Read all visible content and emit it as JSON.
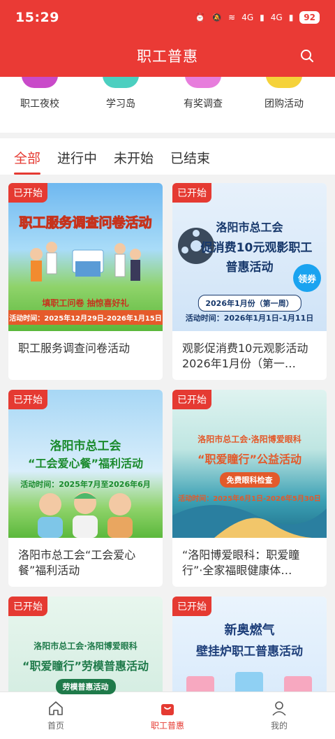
{
  "status_bar": {
    "time": "15:29",
    "signal1": "4G",
    "signal2": "4G",
    "battery": "92"
  },
  "header": {
    "title": "职工普惠"
  },
  "categories": [
    {
      "label": "职工夜校",
      "color": "#c94ac9"
    },
    {
      "label": "学习岛",
      "color": "#4ccfc0"
    },
    {
      "label": "有奖调查",
      "color": "#e77ddc"
    },
    {
      "label": "团购活动",
      "color": "#f5d23a"
    }
  ],
  "tabs": [
    "全部",
    "进行中",
    "未开始",
    "已结束"
  ],
  "cards": [
    {
      "badge": "已开始",
      "title": "职工服务调查问卷活动",
      "img_headline": "职工服务调查问卷活动",
      "img_sub": "填职工问卷 抽惊喜好礼",
      "img_date": "活动时间：2025年12月29日-2026年1月15日"
    },
    {
      "badge": "已开始",
      "title": "观影促消费10元观影活动2026年1月份（第一…",
      "img_line1": "洛阳市总工会",
      "img_line2": "促消费10元观影职工",
      "img_line3": "普惠活动",
      "img_coupon": "领券",
      "img_period": "2026年1月份（第一周）",
      "img_date": "活动时间：2026年1月1日-1月11日"
    },
    {
      "badge": "已开始",
      "title": "洛阳市总工会“工会爱心餐”福利活动",
      "img_line1": "洛阳市总工会",
      "img_line2": "“工会爱心餐”福利活动",
      "img_date": "活动时间：2025年7月至2026年6月"
    },
    {
      "badge": "已开始",
      "title": "“洛阳博爱眼科：职爱瞳行”·全家福眼健康体…",
      "img_line1": "洛阳市总工会·洛阳博爱眼科",
      "img_line2": "“职爱瞳行”公益活动",
      "img_pill": "免费眼科检查",
      "img_date": "活动时间：2025年6月1日-2026年5月30日"
    },
    {
      "badge": "已开始",
      "title": "",
      "img_line1": "洛阳市总工会·洛阳博爱眼科",
      "img_line2": "“职爱瞳行”劳模普惠活动",
      "img_pill": "劳模普惠活动"
    },
    {
      "badge": "已开始",
      "title": "",
      "img_line1": "新奥燃气",
      "img_line2": "壁挂炉职工普惠活动"
    }
  ],
  "bottom_nav": [
    {
      "label": "首页"
    },
    {
      "label": "职工普惠"
    },
    {
      "label": "我的"
    }
  ]
}
